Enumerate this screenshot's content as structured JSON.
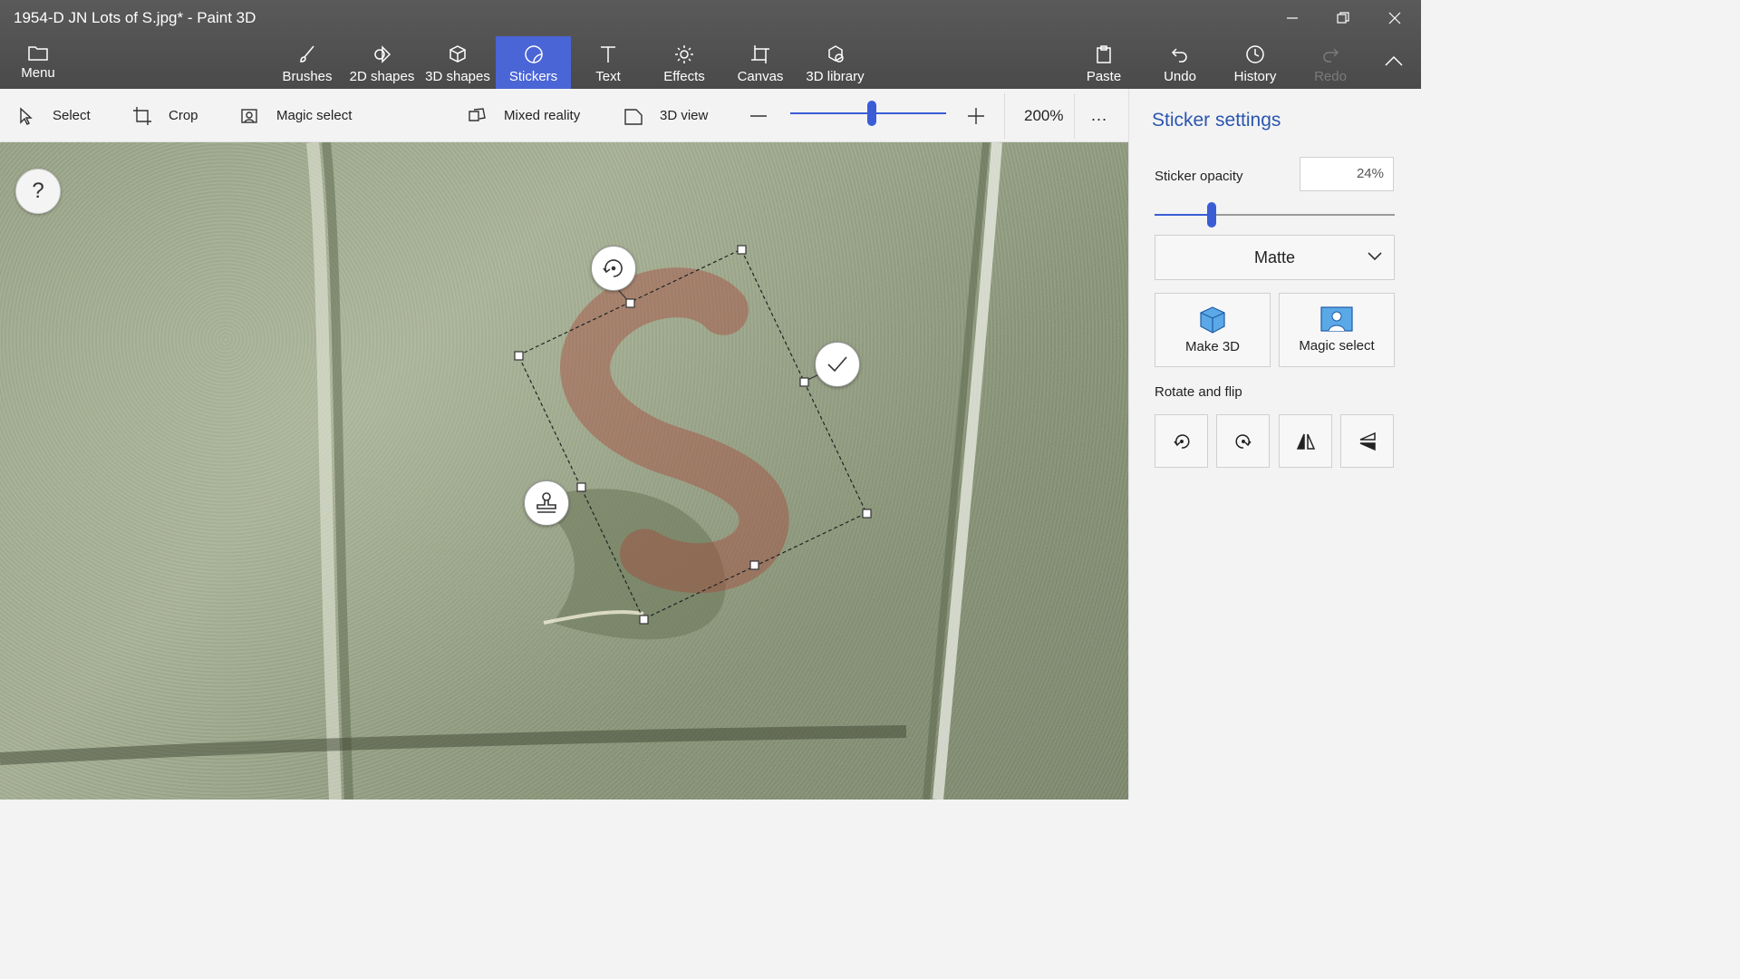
{
  "window": {
    "title": "1954-D JN Lots of S.jpg* - Paint 3D"
  },
  "menu": {
    "label": "Menu"
  },
  "tools": [
    {
      "label": "Brushes",
      "icon": "brush-icon"
    },
    {
      "label": "2D shapes",
      "icon": "2d-shapes-icon"
    },
    {
      "label": "3D shapes",
      "icon": "3d-shapes-icon"
    },
    {
      "label": "Stickers",
      "icon": "stickers-icon",
      "active": true
    },
    {
      "label": "Text",
      "icon": "text-icon"
    },
    {
      "label": "Effects",
      "icon": "effects-icon"
    },
    {
      "label": "Canvas",
      "icon": "canvas-icon"
    },
    {
      "label": "3D library",
      "icon": "3d-library-icon"
    }
  ],
  "right_cmds": {
    "paste": "Paste",
    "undo": "Undo",
    "history": "History",
    "redo": "Redo"
  },
  "toolbar": {
    "select": "Select",
    "crop": "Crop",
    "magic_select": "Magic select",
    "mixed_reality": "Mixed reality",
    "view_3d": "3D view",
    "zoom_value": "200%",
    "more": "..."
  },
  "canvas": {
    "help": "?"
  },
  "panel": {
    "title": "Sticker settings",
    "opacity_label": "Sticker opacity",
    "opacity_value": "24%",
    "finish": "Matte",
    "make3d": "Make 3D",
    "magic_select": "Magic select",
    "rotate_flip": "Rotate and flip"
  },
  "colors": {
    "accent": "#3a5dd6",
    "active_tab": "#4a65d6",
    "panel_title": "#2b56b0",
    "sticker": "#a05a50"
  }
}
